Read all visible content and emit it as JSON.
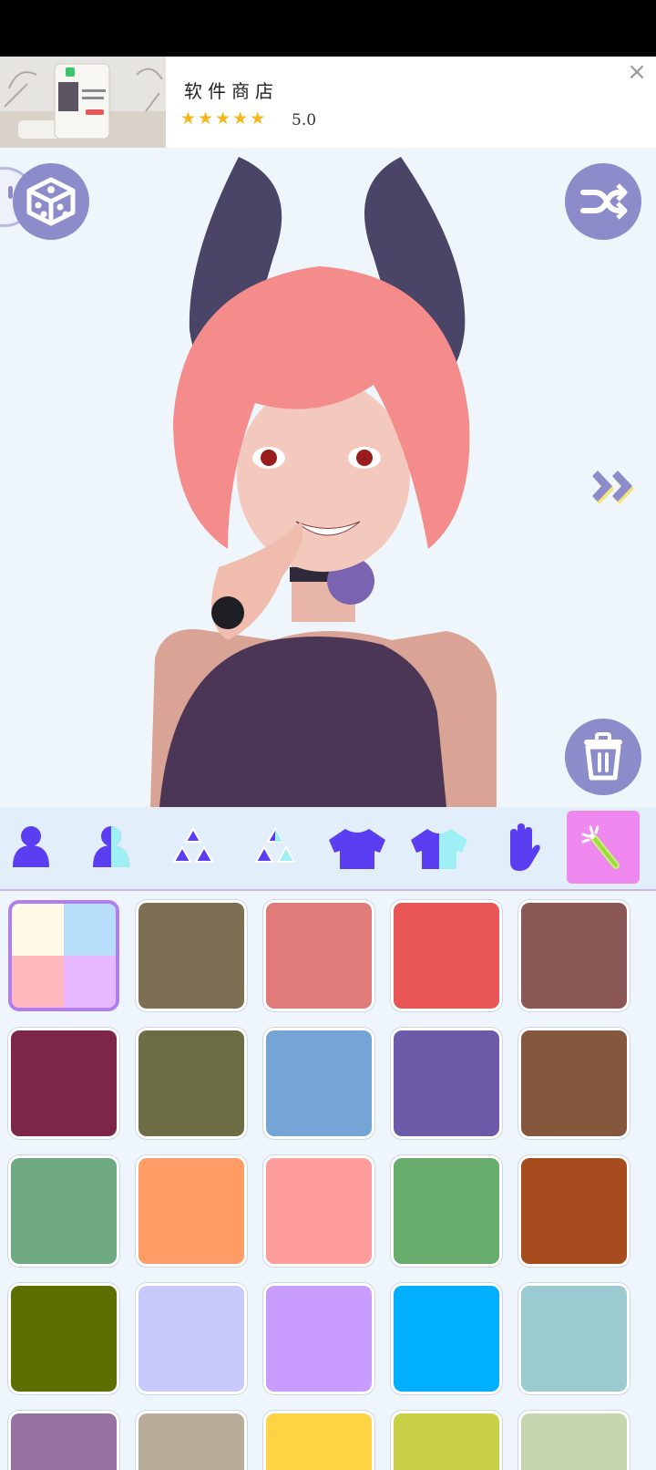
{
  "ad": {
    "title": "软件商店",
    "rating": "5.0",
    "stars": [
      "★",
      "★",
      "★",
      "★",
      "★"
    ],
    "close_icon": "×"
  },
  "stage": {
    "left_button_icon": "dice-icon",
    "right_button_icon": "shuffle-icon",
    "delete_button_icon": "trash-icon",
    "next_icon": "double-chevron-right-icon",
    "button_color": "#8d8ccb"
  },
  "tabs": [
    {
      "name": "body-icon",
      "active": false
    },
    {
      "name": "body-half-icon",
      "active": false
    },
    {
      "name": "triangles-icon",
      "active": false
    },
    {
      "name": "triangles-half-icon",
      "active": false
    },
    {
      "name": "top-icon",
      "active": false
    },
    {
      "name": "top-half-icon",
      "active": false
    },
    {
      "name": "hand-icon",
      "active": false
    },
    {
      "name": "magic-wand-icon",
      "active": true
    }
  ],
  "palette": {
    "selected_index": 0,
    "multi_colors": [
      "#fffbe8",
      "#b7def8",
      "#ffb8bd",
      "#e8b8ff"
    ],
    "colors": [
      "#7d6f53",
      "#e07b79",
      "#e85656",
      "#8b5757",
      "#7c2748",
      "#6d6d45",
      "#74a5d6",
      "#6b5aa8",
      "#85573c",
      "#6faa82",
      "#ff9c66",
      "#ff9c9c",
      "#69ad6c",
      "#a64c1f",
      "#5c7001",
      "#c7c9fa",
      "#c99cff",
      "#00b0fe",
      "#9bcbd1",
      "#97719f",
      "#b8ad98",
      "#fed444",
      "#c8d048",
      "#c6d6ae"
    ]
  }
}
